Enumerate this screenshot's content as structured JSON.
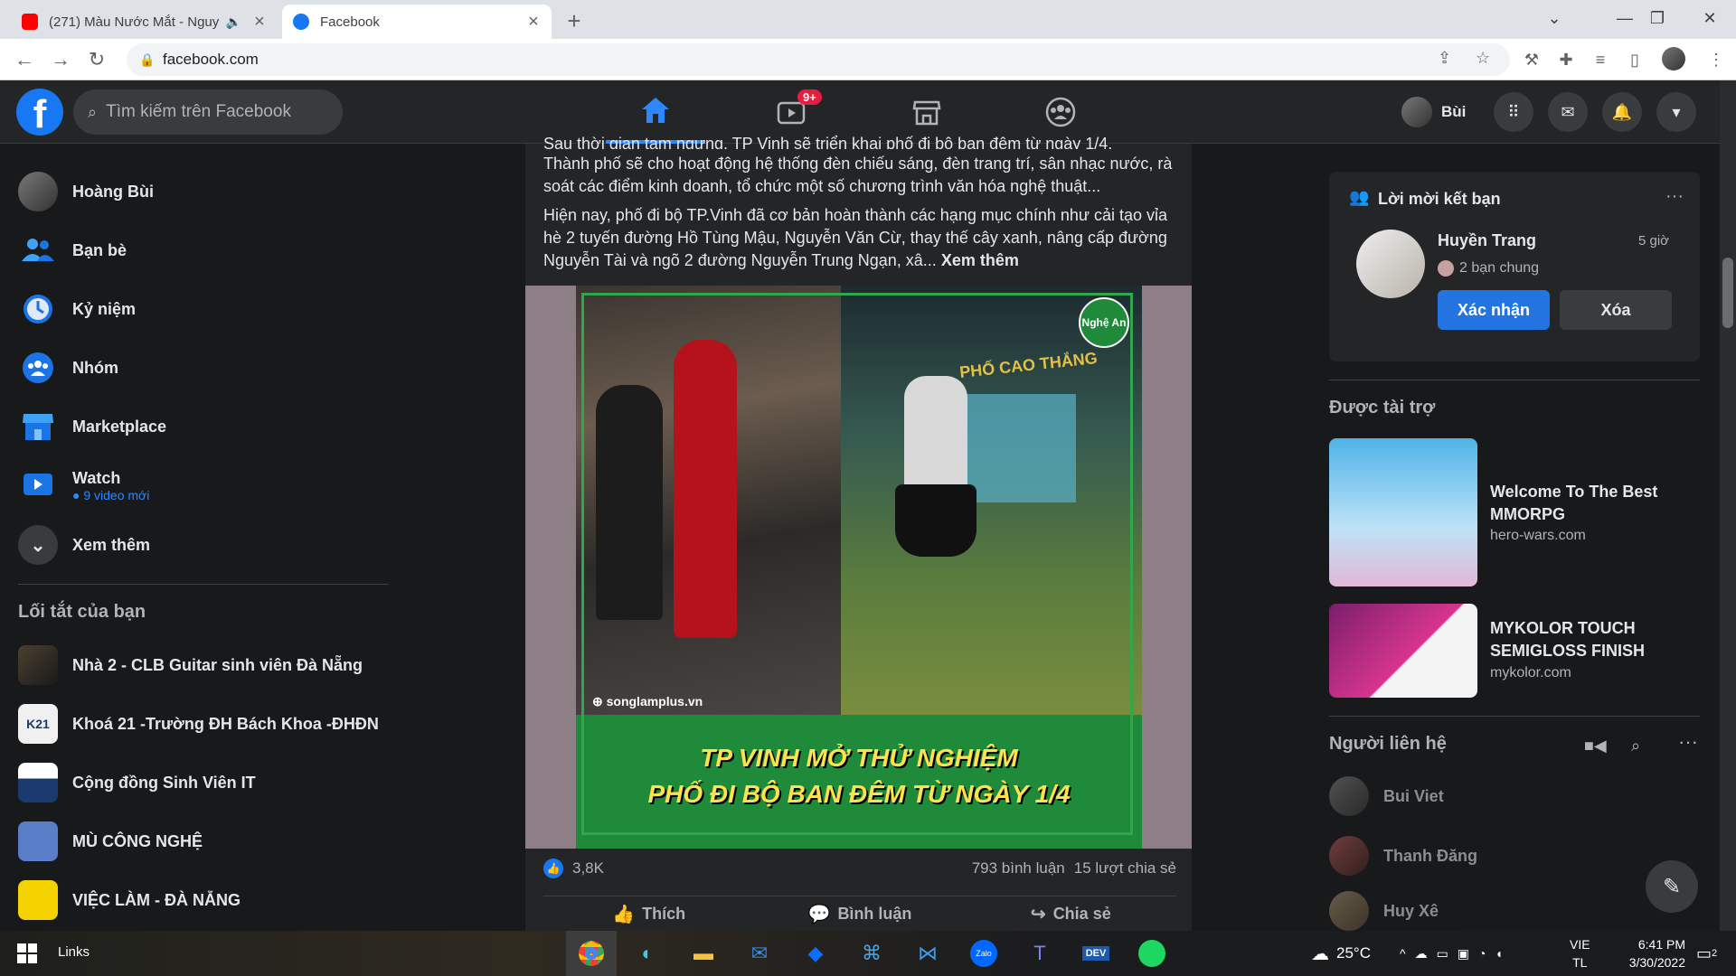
{
  "browser": {
    "tabs": [
      {
        "title": "(271) Màu Nước Mắt - Nguy",
        "favicon_color": "#ff0000",
        "active": false
      },
      {
        "title": "Facebook",
        "favicon_color": "#1877f2",
        "active": true
      }
    ],
    "url": "facebook.com"
  },
  "fb_header": {
    "logo": "f",
    "search_placeholder": "Tìm kiếm trên Facebook",
    "watch_badge": "9+",
    "profile_name": "Bùi"
  },
  "left_sidebar": {
    "items": [
      {
        "label": "Hoàng Bùi",
        "icon": "avatar"
      },
      {
        "label": "Bạn bè",
        "icon": "friends-icon"
      },
      {
        "label": "Kỷ niệm",
        "icon": "memories-icon"
      },
      {
        "label": "Nhóm",
        "icon": "groups-icon"
      },
      {
        "label": "Marketplace",
        "icon": "marketplace-icon"
      },
      {
        "label": "Watch",
        "icon": "watch-icon",
        "sub": "● 9 video mới"
      },
      {
        "label": "Xem thêm",
        "icon": "chevron-down-icon"
      }
    ],
    "shortcuts_title": "Lối tắt của bạn",
    "shortcuts": [
      {
        "label": "Nhà 2 - CLB Guitar sinh viên Đà Nẵng"
      },
      {
        "label": "Khoá 21 -Trường ĐH Bách Khoa -ĐHĐN"
      },
      {
        "label": "Cộng đồng Sinh Viên IT"
      },
      {
        "label": "MÙ CÔNG NGHỆ"
      },
      {
        "label": "VIỆC LÀM - ĐÀ NẴNG"
      }
    ]
  },
  "post": {
    "text_cut": "Sau thời gian tạm ngưng, TP Vinh sẽ triển khai phố đi bộ ban đêm từ ngày 1/4.",
    "paragraph1": "Thành phố sẽ cho hoạt động hệ thống đèn chiếu sáng, đèn trang trí, sân nhạc nước, rà soát các điểm kinh doanh, tổ chức một số chương trình văn hóa nghệ thuật...",
    "paragraph2": "Hiện nay, phố đi bộ TP.Vinh đã cơ bản hoàn thành các hạng mục chính như cải tạo vỉa hè 2 tuyến đường Hồ Tùng Mậu, Nguyễn Văn Cừ, thay thế cây xanh, nâng cấp đường Nguyễn Tài và ngõ 2 đường Nguyễn Trung Ngạn, xâ...",
    "see_more": "Xem thêm",
    "image": {
      "headline_line1": "TP VINH MỞ THỬ NGHIỆM",
      "headline_line2": "PHỐ ĐI BỘ BAN ĐÊM TỪ NGÀY 1/4",
      "watermark": "⊕ songlamplus.vn",
      "badge": "Nghệ An",
      "sign": "PHỐ CAO THẮNG"
    },
    "reactions": "3,8K",
    "comments": "793 bình luận",
    "shares": "15 lượt chia sẻ",
    "actions": {
      "like": "Thích",
      "comment": "Bình luận",
      "share": "Chia sẻ"
    }
  },
  "right": {
    "friend_requests": {
      "title": "Lời mời kết bạn",
      "name": "Huyền Trang",
      "time": "5 giờ",
      "mutual": "2 bạn chung",
      "confirm": "Xác nhận",
      "delete": "Xóa"
    },
    "sponsored_title": "Được tài trợ",
    "ads": [
      {
        "title": "Welcome To The Best MMORPG",
        "domain": "hero-wars.com"
      },
      {
        "title": "MYKOLOR TOUCH SEMIGLOSS FINISH",
        "domain": "mykolor.com"
      }
    ],
    "contacts_title": "Người liên hệ",
    "contacts": [
      "Bui Viet",
      "Thanh Đăng",
      "Huy Xê"
    ]
  },
  "taskbar": {
    "links": "Links",
    "weather": "25°C",
    "lang1": "VIE",
    "lang2": "TL",
    "time": "6:41 PM",
    "date": "3/30/2022",
    "notif_count": "2"
  }
}
